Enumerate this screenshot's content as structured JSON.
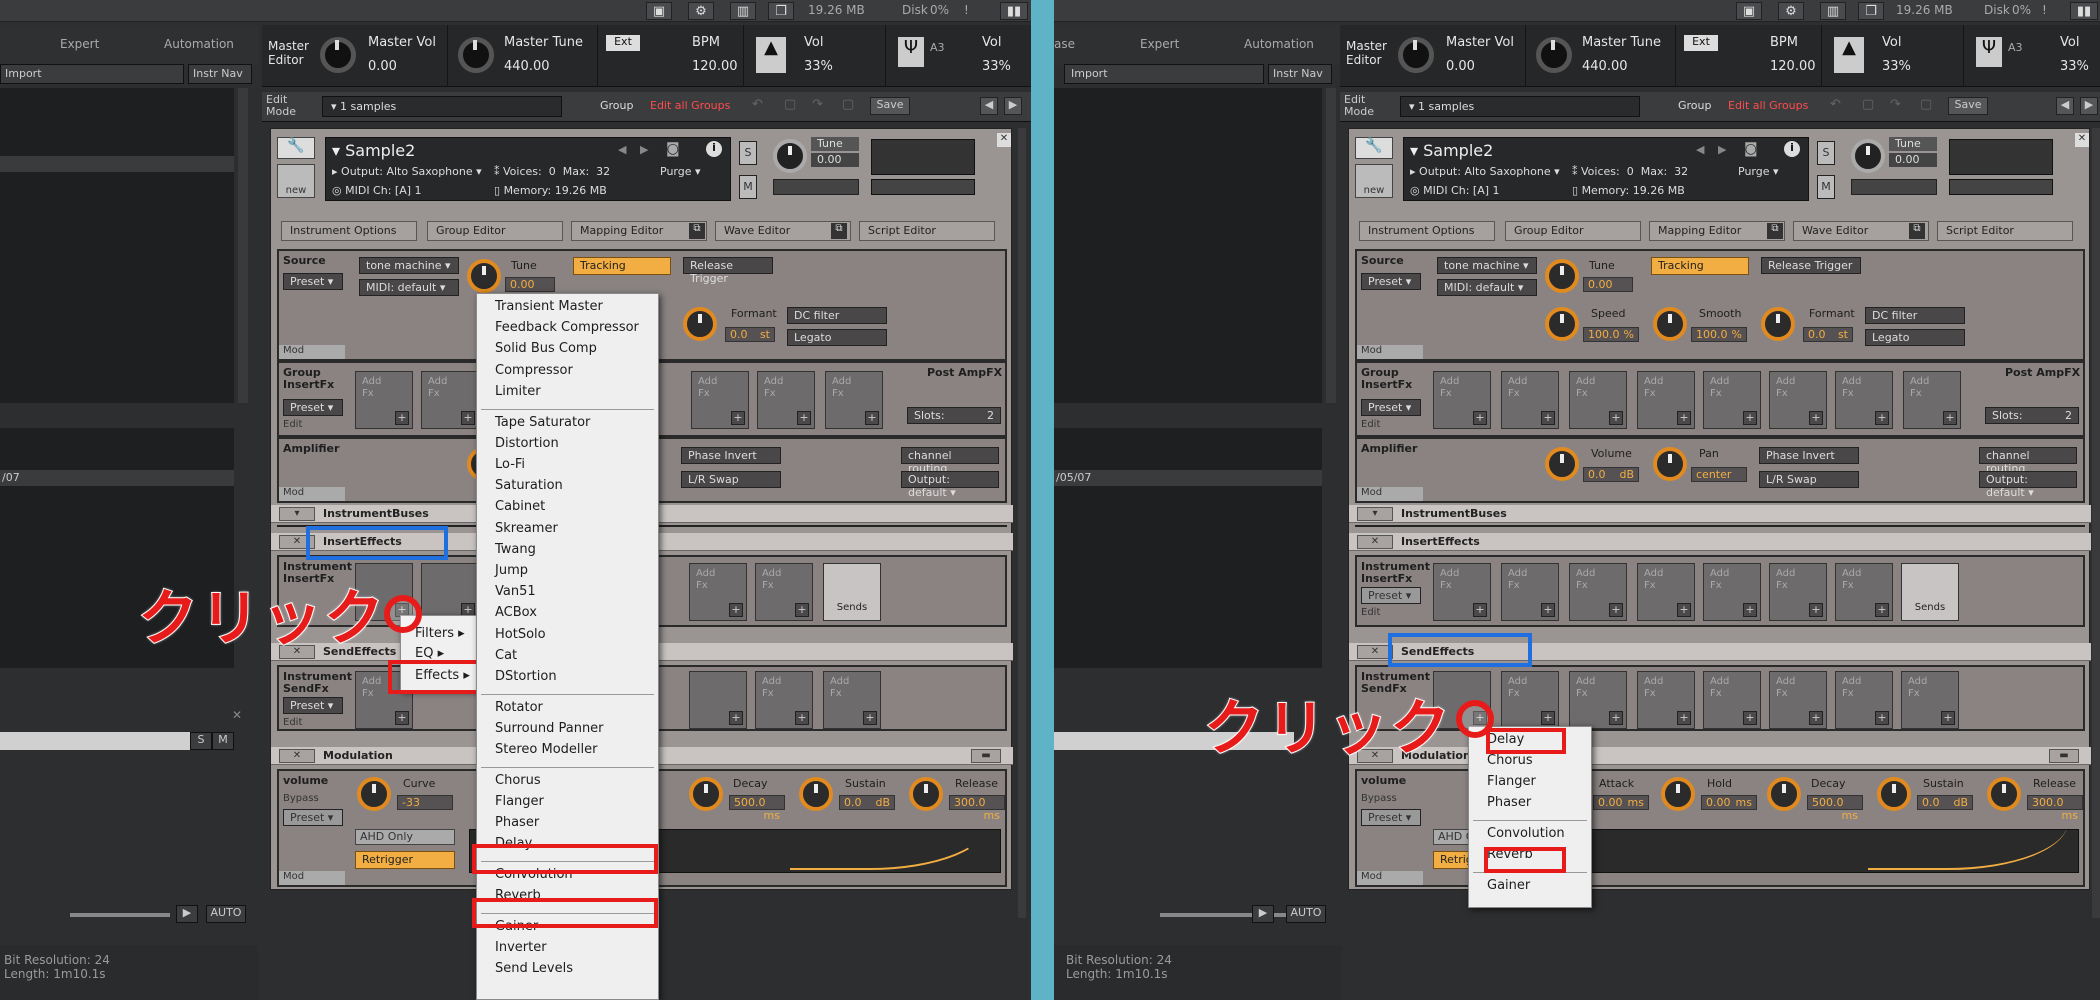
{
  "colors": {
    "accent_orange": "#f2ae43",
    "annotation_red": "#e81b1b",
    "annotation_blue": "#1f6fe0",
    "divider": "#5eb3c6"
  },
  "topbar": {
    "mem": "19.26 MB",
    "disk_label": "Disk",
    "disk_val": "0%",
    "warn": "!"
  },
  "left_header": {
    "expert": "Expert",
    "automation": "Automation",
    "import": "Import",
    "instr_nav": "Instr Nav",
    "path": "/05/07"
  },
  "master": {
    "editor": "Master\nEditor",
    "vol_label": "Master Vol",
    "vol_val": "0.00",
    "tune_label": "Master Tune",
    "tune_val": "440.00",
    "ext": "Ext",
    "bpm_label": "BPM",
    "bpm_val": "120.00",
    "vol2_label": "Vol",
    "vol2_val": "33%",
    "note": "A3",
    "vol3_label": "Vol",
    "vol3_val": "33%"
  },
  "edit": {
    "mode": "Edit\nMode",
    "samples": "1 samples",
    "group": "Group",
    "edit_all_groups": "Edit all Groups",
    "save": "Save"
  },
  "instrument": {
    "name": "Sample2",
    "output_lbl": "Output:",
    "output": "Alto Saxophone",
    "voices_lbl": "Voices:",
    "voices": "0",
    "max_lbl": "Max:",
    "max": "32",
    "purge": "Purge",
    "midi_lbl": "MIDI Ch:",
    "midi": "[A] 1",
    "memory_lbl": "Memory:",
    "memory": "19.26 MB",
    "tune_lbl": "Tune",
    "tune_val": "0.00",
    "new": "new",
    "s": "S",
    "m": "M",
    "info": "i",
    "close": "✕"
  },
  "tabs": [
    "Instrument Options",
    "Group Editor",
    "Mapping Editor",
    "Wave Editor",
    "Script Editor"
  ],
  "source": {
    "label": "Source",
    "mode": "tone machine",
    "preset": "Preset",
    "midi": "MIDI: default",
    "tune_lbl": "Tune",
    "tune": "0.00",
    "tracking": "Tracking",
    "release_trigger": "Release Trigger",
    "speed_lbl": "Speed",
    "speed": "100.0",
    "smooth_lbl": "Smooth",
    "smooth": "100.0",
    "formant_lbl": "Formant",
    "formant": "0.0",
    "dc": "DC filter",
    "legato": "Legato",
    "mod": "Mod",
    "pct": "%",
    "st": "st"
  },
  "group_insert": {
    "label": "Group\nInsertFx",
    "preset": "Preset",
    "edit": "Edit",
    "post": "Post AmpFX",
    "slots_lbl": "Slots:",
    "slots": "2",
    "add_fx": "Add\nFx"
  },
  "amplifier": {
    "label": "Amplifier",
    "vol_lbl": "Volume",
    "vol": "0.0",
    "db": "dB",
    "pan_lbl": "Pan",
    "pan": "center",
    "phase": "Phase Invert",
    "lr": "L/R Swap",
    "routing": "channel routing",
    "output": "Output: default",
    "mod": "Mod"
  },
  "strips": {
    "instrument_buses": "InstrumentBuses",
    "insert_effects": "InsertEffects",
    "send_effects": "SendEffects",
    "modulation": "Modulation"
  },
  "inst_insert": {
    "label": "Instrument\nInsertFx",
    "preset": "Preset",
    "edit": "Edit",
    "sends": "Sends"
  },
  "inst_send": {
    "label": "Instrument\nSendFx",
    "preset": "Preset",
    "edit": "Edit"
  },
  "volume_mod": {
    "label": "volume",
    "bypass": "Bypass",
    "preset": "Preset",
    "curve_lbl": "Curve",
    "curve": "-33",
    "ahd": "AHD Only",
    "retrigger": "Retrigger",
    "attack_lbl": "Attack",
    "attack": "0.00",
    "hold_lbl": "Hold",
    "hold": "0.00",
    "decay_lbl": "Decay",
    "decay": "500.0",
    "sustain_lbl": "Sustain",
    "sustain": "0.0",
    "release_lbl": "Release",
    "release": "300.0",
    "ms": "ms",
    "db": "dB",
    "mod": "Mod"
  },
  "submenu": {
    "filters": "Filters",
    "eq": "EQ",
    "effects": "Effects"
  },
  "menu_left": {
    "group1": [
      "Transient Master",
      "Feedback Compressor",
      "Solid Bus Comp",
      "Compressor",
      "Limiter"
    ],
    "group2": [
      "Tape Saturator",
      "Distortion",
      "Lo-Fi",
      "Saturation",
      "Cabinet",
      "Skreamer",
      "Twang",
      "Jump",
      "Van51",
      "ACBox",
      "HotSolo",
      "Cat",
      "DStortion"
    ],
    "group3": [
      "Rotator",
      "Surround Panner",
      "Stereo Modeller"
    ],
    "group4": [
      "Chorus",
      "Flanger",
      "Phaser",
      "Delay"
    ],
    "group5": [
      "Convolution",
      "Reverb"
    ],
    "group6": [
      "Gainer",
      "Inverter",
      "Send Levels"
    ]
  },
  "menu_right": {
    "group1": [
      "Delay",
      "Chorus",
      "Flanger",
      "Phaser"
    ],
    "group2": [
      "Convolution",
      "Reverb"
    ],
    "group3": [
      "Gainer"
    ]
  },
  "annotation": {
    "click": "クリック"
  },
  "bottom": {
    "bit": "Bit Resolution: 24",
    "length": "Length: 1m10.1s",
    "auto": "AUTO",
    "play": "▶"
  },
  "left_list": {
    "path": "/07",
    "s": "S",
    "m": "M"
  }
}
